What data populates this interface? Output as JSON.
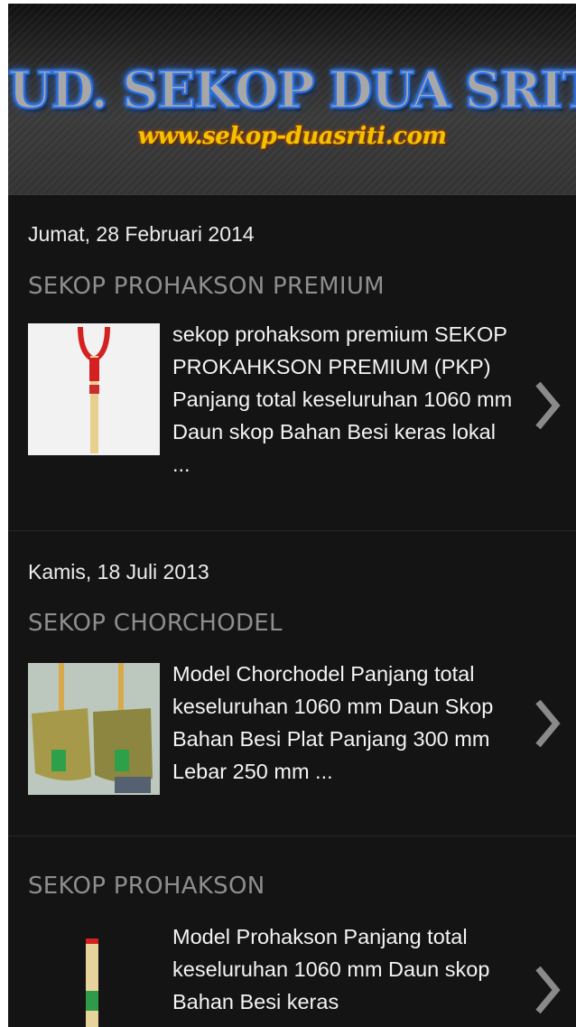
{
  "header": {
    "title": "UD. SEKOP DUA SRITI",
    "url": "www.sekop-duasriti.com"
  },
  "posts": [
    {
      "date": "Jumat, 28 Februari 2014",
      "title": "SEKOP PROHAKSON PREMIUM",
      "snippet": "sekop prohaksom premium SEKOP PROKAHKSON PREMIUM (PKP) Panjang total keseluruhan   1060 mm Daun skop Bahan Besi keras lokal ...",
      "thumb_icon": "shovel-red-handle-image"
    },
    {
      "date": "Kamis, 18 Juli 2013",
      "title": "SEKOP CHORCHODEL",
      "snippet": "Model Chorchodel Panjang total keseluruhan   1060 mm Daun Skop Bahan Besi Plat Panjang 300 mm Lebar 250 mm ...",
      "thumb_icon": "shovels-pair-image"
    },
    {
      "date": "",
      "title": "SEKOP PROHAKSON",
      "snippet": "Model Prohakson Panjang total keseluruhan   1060 mm Daun skop Bahan Besi keras",
      "thumb_icon": "shovel-handle-image"
    }
  ],
  "colors": {
    "background": "#141414",
    "title_stroke": "#2a6fe8",
    "url_text": "#f0c400"
  }
}
